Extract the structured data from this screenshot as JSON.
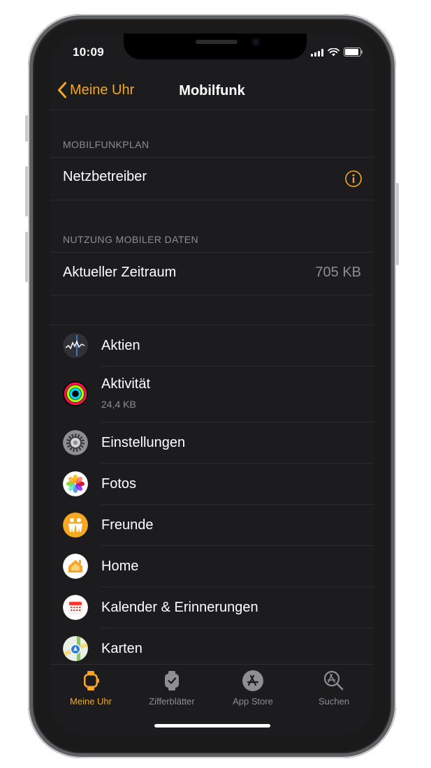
{
  "status": {
    "time": "10:09"
  },
  "nav": {
    "back_label": "Meine Uhr",
    "title": "Mobilfunk"
  },
  "plan": {
    "header": "MOBILFUNKPLAN",
    "carrier_label": "Netzbetreiber"
  },
  "usage": {
    "header": "NUTZUNG MOBILER DATEN",
    "period_label": "Aktueller Zeitraum",
    "period_value": "705 KB"
  },
  "apps": [
    {
      "label": "Aktien",
      "icon": "stocks-icon"
    },
    {
      "label": "Aktivität",
      "sub": "24,4 KB",
      "icon": "activity-icon"
    },
    {
      "label": "Einstellungen",
      "icon": "settings-icon"
    },
    {
      "label": "Fotos",
      "icon": "photos-icon"
    },
    {
      "label": "Freunde",
      "icon": "friends-icon"
    },
    {
      "label": "Home",
      "icon": "home-icon"
    },
    {
      "label": "Kalender & Erinnerungen",
      "icon": "calendar-icon"
    },
    {
      "label": "Karten",
      "icon": "maps-icon"
    }
  ],
  "tabs": [
    {
      "label": "Meine Uhr",
      "icon": "watch-icon",
      "active": true
    },
    {
      "label": "Zifferblätter",
      "icon": "watch-face-icon",
      "active": false
    },
    {
      "label": "App Store",
      "icon": "app-store-icon",
      "active": false
    },
    {
      "label": "Suchen",
      "icon": "search-icon",
      "active": false
    }
  ],
  "colors": {
    "accent": "#f5a623",
    "background": "#1c1c1e",
    "secondary_text": "#8e8e93"
  }
}
